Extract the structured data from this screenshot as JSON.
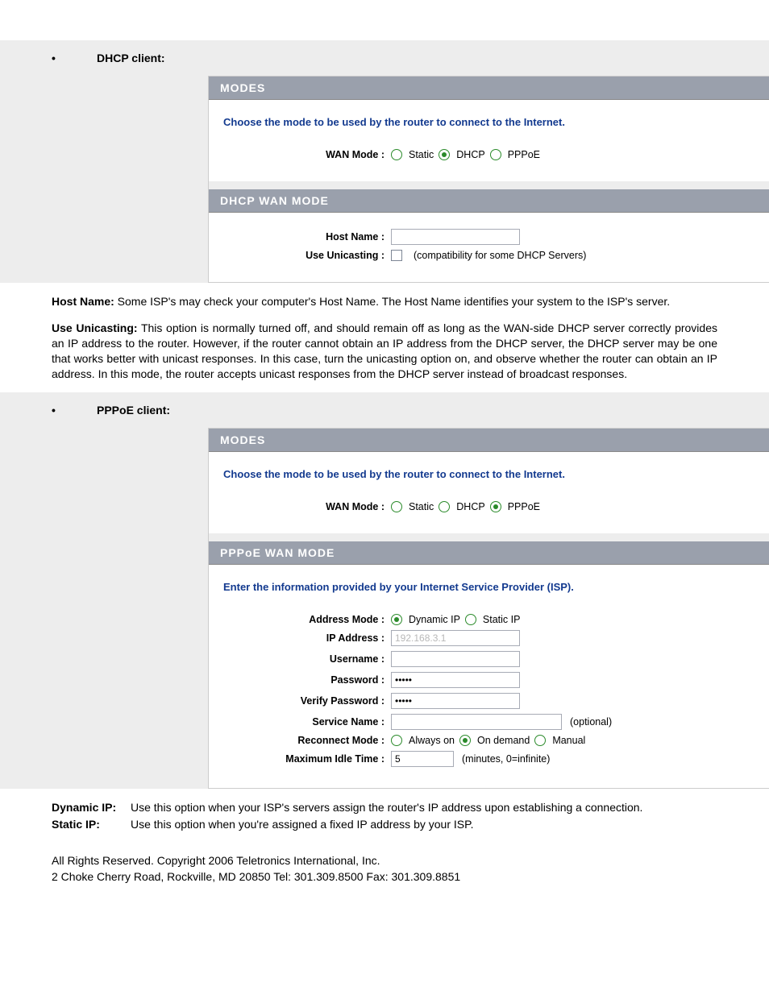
{
  "sections": {
    "dhcp_title": "DHCP client:",
    "pppoe_title": "PPPoE client:"
  },
  "modes_header": "MODES",
  "dhcp_wan_header": "DHCP WAN MODE",
  "pppoe_wan_header": "PPPoE WAN MODE",
  "instruction_mode": "Choose the mode to be used by the router to connect to the Internet.",
  "instruction_pppoe": "Enter the information provided by your Internet Service Provider (ISP).",
  "labels": {
    "wan_mode": "WAN Mode :",
    "host_name": "Host Name :",
    "use_unicasting": "Use Unicasting :",
    "address_mode": "Address Mode :",
    "ip_address": "IP Address :",
    "username": "Username :",
    "password": "Password :",
    "verify_password": "Verify Password :",
    "service_name": "Service Name :",
    "reconnect_mode": "Reconnect Mode :",
    "max_idle": "Maximum Idle Time :"
  },
  "options": {
    "static": "Static",
    "dhcp": "DHCP",
    "pppoe": "PPPoE",
    "dynamic_ip": "Dynamic IP",
    "static_ip": "Static IP",
    "always_on": "Always on",
    "on_demand": "On demand",
    "manual": "Manual"
  },
  "hints": {
    "unicasting": "(compatibility for some DHCP Servers)",
    "optional": "(optional)",
    "idle": "(minutes, 0=infinite)"
  },
  "values": {
    "ip_address": "192.168.3.1",
    "password": "•••••",
    "verify_password": "•••••",
    "max_idle": "5"
  },
  "descriptions": {
    "host_name_term": "Host Name:",
    "host_name_text": " Some ISP's may check your computer's Host Name. The Host Name identifies your system to the ISP's server.",
    "unicasting_term": "Use Unicasting:",
    "unicasting_text": " This option is normally turned off, and should remain off as long as the WAN-side DHCP server correctly provides an IP address to the router. However, if the router cannot obtain an IP address from the DHCP server, the DHCP server may be one that works better with unicast responses. In this case, turn the unicasting option on, and observe whether the router can obtain an IP address. In this mode, the router accepts unicast responses from the DHCP server instead of broadcast responses.",
    "dynamic_ip_term": "Dynamic IP:",
    "dynamic_ip_text": "Use this option when your ISP's servers assign the router's IP address upon establishing a connection.",
    "static_ip_term": "Static IP:",
    "static_ip_text": "Use this option when you're assigned a fixed IP address by your ISP."
  },
  "footer": {
    "line1": "All Rights Reserved. Copyright 2006 Teletronics International, Inc.",
    "line2": "2 Choke Cherry Road, Rockville, MD 20850    Tel: 301.309.8500 Fax: 301.309.8851"
  }
}
